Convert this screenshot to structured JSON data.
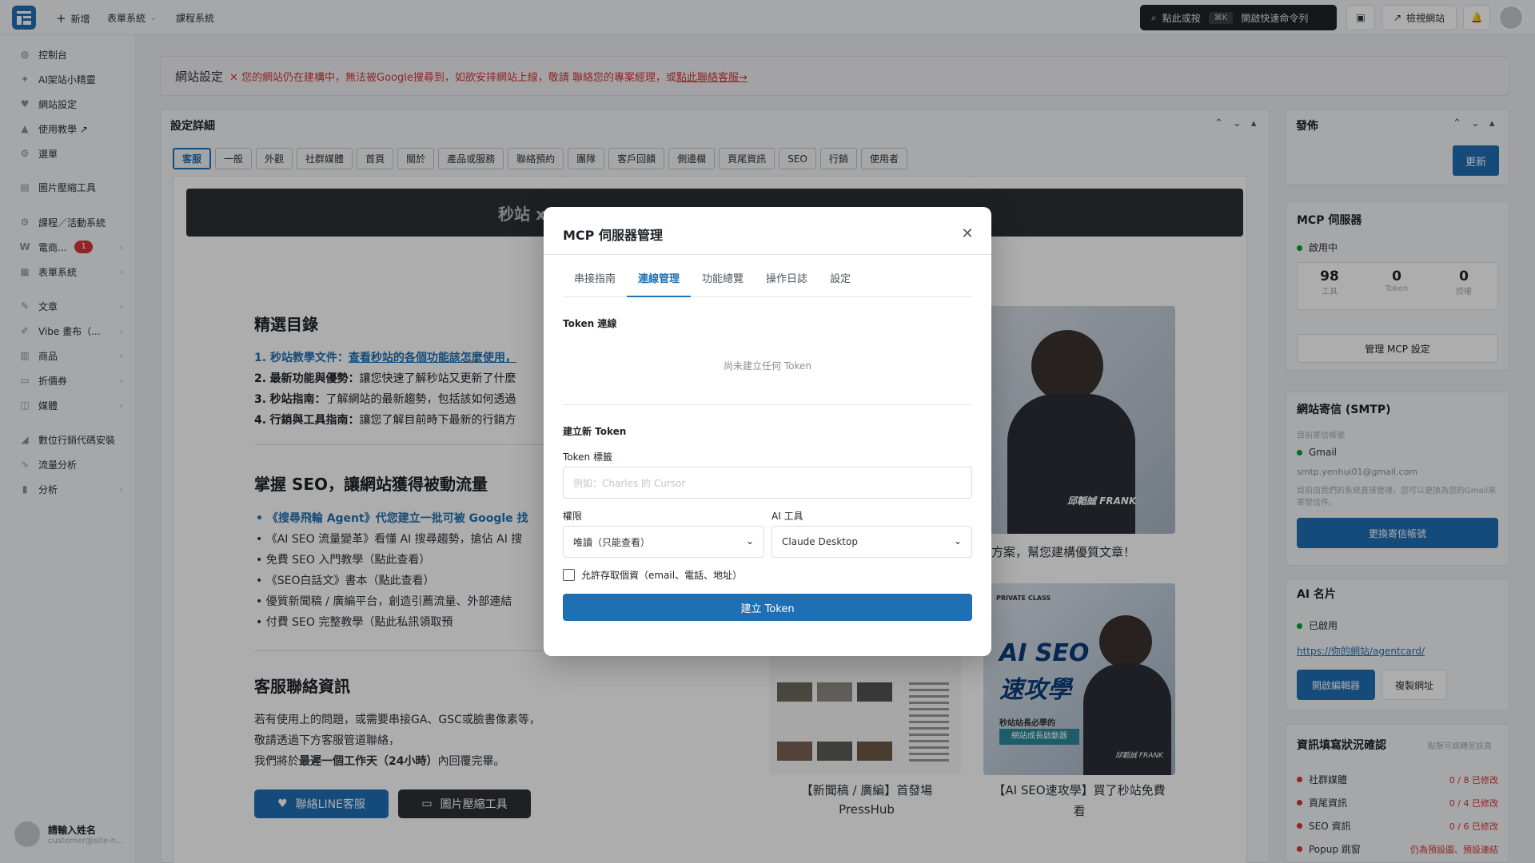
{
  "topbar": {
    "new_label": "新增",
    "form_system_label": "表單系統",
    "course_system_label": "課程系統",
    "command_search": "點此或按",
    "command_shortcut": "⌘K",
    "command_open": "開啟快速命令列",
    "view_site_label": "檢視網站"
  },
  "sidebar": {
    "items": [
      {
        "label": "控制台",
        "icon": "dashboard-icon"
      },
      {
        "label": "AI架站小精靈",
        "icon": "wand-icon"
      },
      {
        "label": "網站設定",
        "icon": "heart-icon"
      },
      {
        "label": "使用教學 ↗",
        "icon": "cap-icon"
      },
      {
        "label": "選單",
        "icon": "gear-icon"
      },
      {
        "label": "圖片壓縮工具",
        "icon": "image-icon"
      },
      {
        "label": "課程／活動系統",
        "icon": "gear-icon"
      },
      {
        "label": "電商...",
        "icon": "woo-icon",
        "badge": "1"
      },
      {
        "label": "表單系統",
        "icon": "form-icon"
      },
      {
        "label": "文章",
        "icon": "pin-icon"
      },
      {
        "label": "Vibe 畫布（...",
        "icon": "brush-icon"
      },
      {
        "label": "商品",
        "icon": "box-icon"
      },
      {
        "label": "折價券",
        "icon": "ticket-icon"
      },
      {
        "label": "媒體",
        "icon": "media-icon"
      },
      {
        "label": "數位行銷代碼安裝",
        "icon": "chart-icon"
      },
      {
        "label": "流量分析",
        "icon": "line-icon"
      },
      {
        "label": "分析",
        "icon": "bars-icon"
      }
    ],
    "user_name": "請輸入姓名",
    "user_email": "customer@site-n..."
  },
  "notice": {
    "title": "網站設定",
    "warning": "✕ 您的網站仍在建構中，無法被Google搜尋到，如欲安排網站上線，敬請 聯絡您的專案經理，或",
    "link": "點此聯絡客服→"
  },
  "settings": {
    "title": "設定詳細",
    "tabs": [
      "客服",
      "一般",
      "外觀",
      "社群媒體",
      "首頁",
      "關於",
      "產品或服務",
      "聯絡預約",
      "團隊",
      "客戶回饋",
      "側邊欄",
      "頁尾資訊",
      "SEO",
      "行銷",
      "使用者"
    ],
    "active_tab": "客服",
    "banner": "秒站 x",
    "catalog_title": "精選目錄",
    "catalog": [
      {
        "num": "1.",
        "label": "秒站教學文件：",
        "text": "查看秒站的各個功能該怎麼使用，"
      },
      {
        "num": "2.",
        "label": "最新功能與優勢：",
        "text": "讓您快速了解秒站又更新了什麼"
      },
      {
        "num": "3.",
        "label": "秒站指南：",
        "text": "了解網站的最新趨勢，包括該如何透過"
      },
      {
        "num": "4.",
        "label": "行銷與工具指南：",
        "text": "讓您了解目前時下最新的行銷方"
      }
    ],
    "seo_title": "掌握 SEO，讓網站獲得被動流量",
    "seo_items": [
      "《搜尋飛輪 Agent》代您建立一批可被 Google 找",
      "《AI SEO 流量變革》看懂 AI 搜尋趨勢，搶佔 AI 搜",
      "免費 SEO 入門教學（點此查看）",
      "《SEO白話文》書本（點此查看）",
      "優質新聞稿 / 廣編平台，創造引薦流量、外部連結",
      "付費 SEO 完整教學（點此私訊領取預"
    ],
    "contact_title": "客服聯絡資訊",
    "contact_p1": "若有使用上的問題，或需要串接GA、GSC或臉書像素等，",
    "contact_p2": "敬請透過下方客服管道聯絡，",
    "contact_p3a": "我們將於",
    "contact_p3b": "最遲一個工作天（24小時）",
    "contact_p3c": "內回覆完畢。",
    "line_btn": "聯絡LINE客服",
    "img_btn": "圖片壓縮工具",
    "card_caption1": "方案，幫您建構優質文章！",
    "card_caption2a": "【新聞稿 / 廣編】首發場",
    "card_caption2b": "PressHub",
    "card_caption3a": "【AI SEO速攻學】買了秒站免費",
    "card_caption3b": "看",
    "card_name1": "邱韜誠 FRANK",
    "card_name2": "邱韜誠 FRANK",
    "card_ai_seo_1": "AI SEO",
    "card_ai_seo_2": "速攻學",
    "card_ai_sub": "網站成長啟動器",
    "card_top_text": "PRIVATE CLASS",
    "card_tag_1": "秒站站長必學的"
  },
  "publish": {
    "title": "發佈",
    "update_btn": "更新"
  },
  "mcp_panel": {
    "title": "MCP 伺服器",
    "status": "啟用中",
    "stats": [
      {
        "value": "98",
        "label": "工具"
      },
      {
        "value": "0",
        "label": "Token"
      },
      {
        "value": "0",
        "label": "授權"
      }
    ],
    "manage_btn": "管理 MCP 設定"
  },
  "smtp_panel": {
    "title": "網站寄信 (SMTP)",
    "current_label": "目前寄信帳號",
    "provider": "Gmail",
    "email": "smtp.yenhui01@gmail.com",
    "note": "目前由我們的系統直接管理，您可以更換為您的Gmail來寄發信件。",
    "change_btn": "更換寄信帳號"
  },
  "ai_card_panel": {
    "title": "AI 名片",
    "status": "已啟用",
    "url": "https://你的網站/agentcard/",
    "edit_btn": "開啟編輯器",
    "copy_btn": "複製網址"
  },
  "info_check": {
    "title": "資訊填寫狀況確認",
    "hint": "點擊可跳轉至該頁",
    "rows": [
      {
        "label": "社群媒體",
        "value": "0 / 8 已修改"
      },
      {
        "label": "頁尾資訊",
        "value": "0 / 4 已修改"
      },
      {
        "label": "SEO 資訊",
        "value": "0 / 6 已修改"
      },
      {
        "label": "Popup 跳窗",
        "value": "仍為預設圖、預設連結"
      }
    ]
  },
  "modal": {
    "title": "MCP 伺服器管理",
    "tabs": [
      "串接指南",
      "連線管理",
      "功能總覽",
      "操作日誌",
      "設定"
    ],
    "active_tab": "連線管理",
    "token_section": "Token 連線",
    "empty_text": "尚未建立任何 Token",
    "create_section": "建立新 Token",
    "token_label": "Token 標籤",
    "token_placeholder": "例如：Charles 的 Cursor",
    "perm_label": "權限",
    "perm_value": "唯讀（只能查看）",
    "ai_tool_label": "AI 工具",
    "ai_tool_value": "Claude Desktop",
    "checkbox_label": "允許存取個資（email、電話、地址）",
    "submit": "建立 Token"
  },
  "colors": {
    "primary": "#1f6fb5",
    "danger": "#d63638",
    "success": "#00a32a",
    "dark_bar": "#1f2328"
  }
}
